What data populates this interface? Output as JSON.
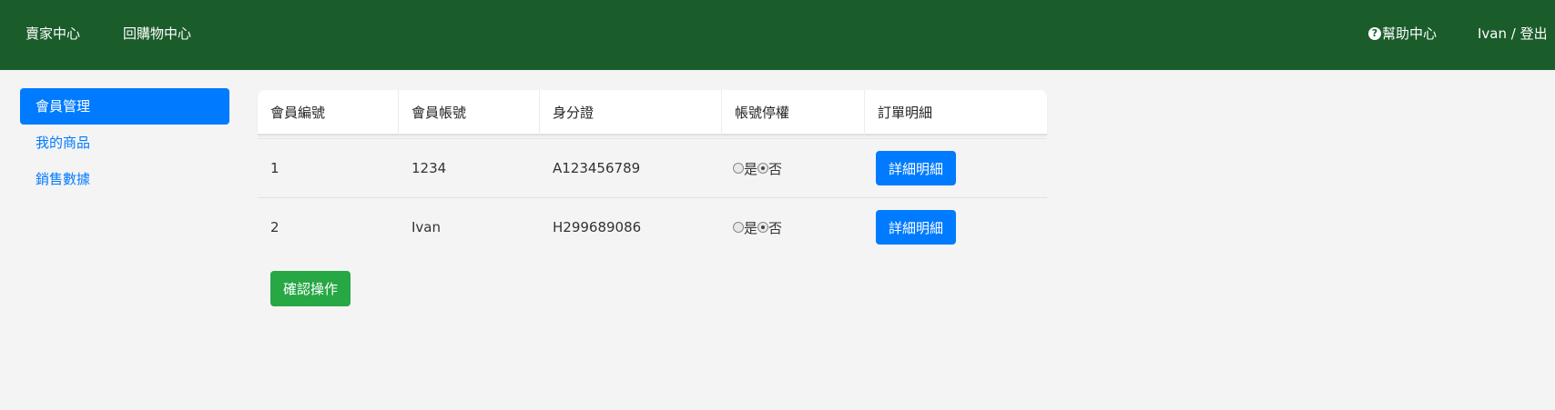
{
  "header": {
    "seller_center": "賣家中心",
    "back_to_shop": "回購物中心",
    "help_center": "幫助中心",
    "help_icon": "?",
    "user_logout": "Ivan / 登出"
  },
  "sidebar": {
    "items": [
      {
        "label": "會員管理",
        "active": true
      },
      {
        "label": "我的商品",
        "active": false
      },
      {
        "label": "銷售數據",
        "active": false
      }
    ]
  },
  "table": {
    "columns": [
      "會員編號",
      "會員帳號",
      "身分證",
      "帳號停權",
      "訂單明細"
    ],
    "rows": [
      {
        "id": "1",
        "account": "1234",
        "national_id": "A123456789",
        "suspend_yes": "是",
        "suspend_no": "否",
        "suspended": false,
        "detail_label": "詳細明細"
      },
      {
        "id": "2",
        "account": "Ivan",
        "national_id": "H299689086",
        "suspend_yes": "是",
        "suspend_no": "否",
        "suspended": false,
        "detail_label": "詳細明細"
      }
    ]
  },
  "confirm_label": "確認操作",
  "colors": {
    "header_bg": "#1a5c2a",
    "primary": "#007bff",
    "success": "#28a745",
    "page_bg": "#f4f4f4"
  }
}
